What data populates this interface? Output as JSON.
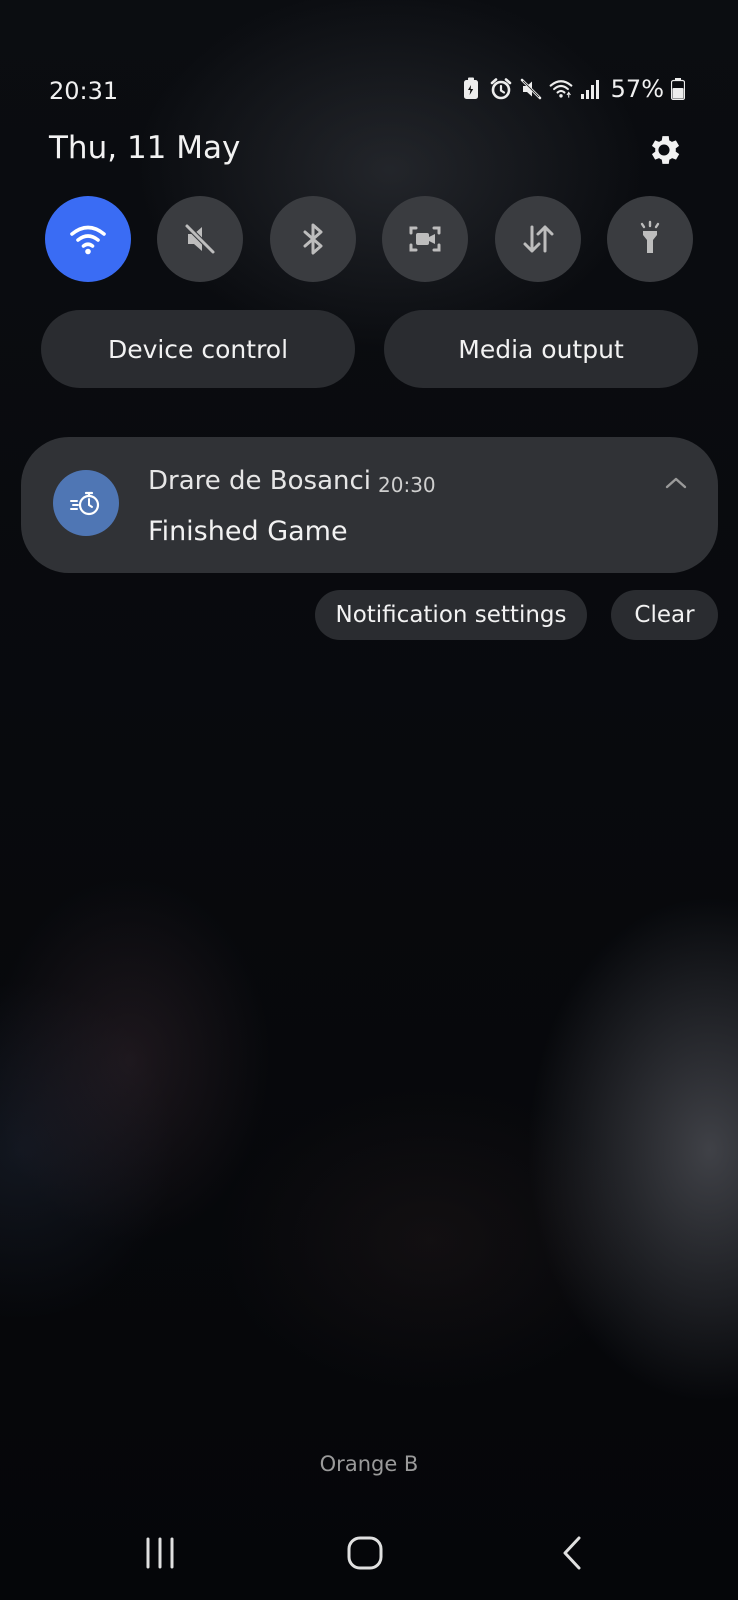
{
  "status_bar": {
    "time": "20:31",
    "battery_percent": "57%",
    "icons": [
      "battery-saver-icon",
      "alarm-icon",
      "mute-icon",
      "wifi-icon",
      "signal-icon",
      "battery-icon"
    ]
  },
  "header": {
    "date": "Thu, 11 May",
    "settings_icon": "gear-icon"
  },
  "quick_toggles": [
    {
      "name": "wifi",
      "icon": "wifi-icon",
      "state": "on"
    },
    {
      "name": "sound",
      "icon": "mute-icon",
      "state": "off"
    },
    {
      "name": "bluetooth",
      "icon": "bluetooth-icon",
      "state": "off"
    },
    {
      "name": "screen-recorder",
      "icon": "screen-recorder-icon",
      "state": "off"
    },
    {
      "name": "mobile-data",
      "icon": "data-arrows-icon",
      "state": "off"
    },
    {
      "name": "flashlight",
      "icon": "flashlight-icon",
      "state": "off"
    }
  ],
  "actions": {
    "device_control": "Device control",
    "media_output": "Media output"
  },
  "notification": {
    "app_name": "Drare de Bosanci",
    "time": "20:30",
    "body": "Finished Game",
    "icon": "stopwatch-icon"
  },
  "notification_actions": {
    "settings": "Notification settings",
    "clear": "Clear"
  },
  "carrier": "Orange B",
  "colors": {
    "accent_toggle": "#3a6cf4",
    "app_icon_bg": "#4f76b4",
    "toggle_off": "#3a3c40",
    "card_bg": "#303236"
  }
}
